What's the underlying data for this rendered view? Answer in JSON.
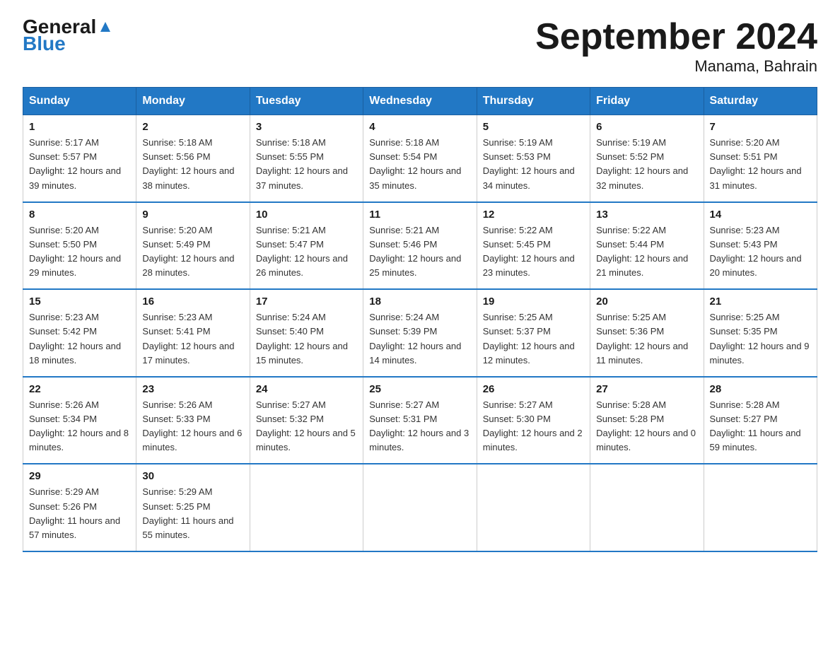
{
  "header": {
    "logo_general": "General",
    "logo_blue": "Blue",
    "title": "September 2024",
    "subtitle": "Manama, Bahrain"
  },
  "days_of_week": [
    "Sunday",
    "Monday",
    "Tuesday",
    "Wednesday",
    "Thursday",
    "Friday",
    "Saturday"
  ],
  "weeks": [
    [
      {
        "day": "1",
        "sunrise": "5:17 AM",
        "sunset": "5:57 PM",
        "daylight": "12 hours and 39 minutes."
      },
      {
        "day": "2",
        "sunrise": "5:18 AM",
        "sunset": "5:56 PM",
        "daylight": "12 hours and 38 minutes."
      },
      {
        "day": "3",
        "sunrise": "5:18 AM",
        "sunset": "5:55 PM",
        "daylight": "12 hours and 37 minutes."
      },
      {
        "day": "4",
        "sunrise": "5:18 AM",
        "sunset": "5:54 PM",
        "daylight": "12 hours and 35 minutes."
      },
      {
        "day": "5",
        "sunrise": "5:19 AM",
        "sunset": "5:53 PM",
        "daylight": "12 hours and 34 minutes."
      },
      {
        "day": "6",
        "sunrise": "5:19 AM",
        "sunset": "5:52 PM",
        "daylight": "12 hours and 32 minutes."
      },
      {
        "day": "7",
        "sunrise": "5:20 AM",
        "sunset": "5:51 PM",
        "daylight": "12 hours and 31 minutes."
      }
    ],
    [
      {
        "day": "8",
        "sunrise": "5:20 AM",
        "sunset": "5:50 PM",
        "daylight": "12 hours and 29 minutes."
      },
      {
        "day": "9",
        "sunrise": "5:20 AM",
        "sunset": "5:49 PM",
        "daylight": "12 hours and 28 minutes."
      },
      {
        "day": "10",
        "sunrise": "5:21 AM",
        "sunset": "5:47 PM",
        "daylight": "12 hours and 26 minutes."
      },
      {
        "day": "11",
        "sunrise": "5:21 AM",
        "sunset": "5:46 PM",
        "daylight": "12 hours and 25 minutes."
      },
      {
        "day": "12",
        "sunrise": "5:22 AM",
        "sunset": "5:45 PM",
        "daylight": "12 hours and 23 minutes."
      },
      {
        "day": "13",
        "sunrise": "5:22 AM",
        "sunset": "5:44 PM",
        "daylight": "12 hours and 21 minutes."
      },
      {
        "day": "14",
        "sunrise": "5:23 AM",
        "sunset": "5:43 PM",
        "daylight": "12 hours and 20 minutes."
      }
    ],
    [
      {
        "day": "15",
        "sunrise": "5:23 AM",
        "sunset": "5:42 PM",
        "daylight": "12 hours and 18 minutes."
      },
      {
        "day": "16",
        "sunrise": "5:23 AM",
        "sunset": "5:41 PM",
        "daylight": "12 hours and 17 minutes."
      },
      {
        "day": "17",
        "sunrise": "5:24 AM",
        "sunset": "5:40 PM",
        "daylight": "12 hours and 15 minutes."
      },
      {
        "day": "18",
        "sunrise": "5:24 AM",
        "sunset": "5:39 PM",
        "daylight": "12 hours and 14 minutes."
      },
      {
        "day": "19",
        "sunrise": "5:25 AM",
        "sunset": "5:37 PM",
        "daylight": "12 hours and 12 minutes."
      },
      {
        "day": "20",
        "sunrise": "5:25 AM",
        "sunset": "5:36 PM",
        "daylight": "12 hours and 11 minutes."
      },
      {
        "day": "21",
        "sunrise": "5:25 AM",
        "sunset": "5:35 PM",
        "daylight": "12 hours and 9 minutes."
      }
    ],
    [
      {
        "day": "22",
        "sunrise": "5:26 AM",
        "sunset": "5:34 PM",
        "daylight": "12 hours and 8 minutes."
      },
      {
        "day": "23",
        "sunrise": "5:26 AM",
        "sunset": "5:33 PM",
        "daylight": "12 hours and 6 minutes."
      },
      {
        "day": "24",
        "sunrise": "5:27 AM",
        "sunset": "5:32 PM",
        "daylight": "12 hours and 5 minutes."
      },
      {
        "day": "25",
        "sunrise": "5:27 AM",
        "sunset": "5:31 PM",
        "daylight": "12 hours and 3 minutes."
      },
      {
        "day": "26",
        "sunrise": "5:27 AM",
        "sunset": "5:30 PM",
        "daylight": "12 hours and 2 minutes."
      },
      {
        "day": "27",
        "sunrise": "5:28 AM",
        "sunset": "5:28 PM",
        "daylight": "12 hours and 0 minutes."
      },
      {
        "day": "28",
        "sunrise": "5:28 AM",
        "sunset": "5:27 PM",
        "daylight": "11 hours and 59 minutes."
      }
    ],
    [
      {
        "day": "29",
        "sunrise": "5:29 AM",
        "sunset": "5:26 PM",
        "daylight": "11 hours and 57 minutes."
      },
      {
        "day": "30",
        "sunrise": "5:29 AM",
        "sunset": "5:25 PM",
        "daylight": "11 hours and 55 minutes."
      },
      null,
      null,
      null,
      null,
      null
    ]
  ]
}
